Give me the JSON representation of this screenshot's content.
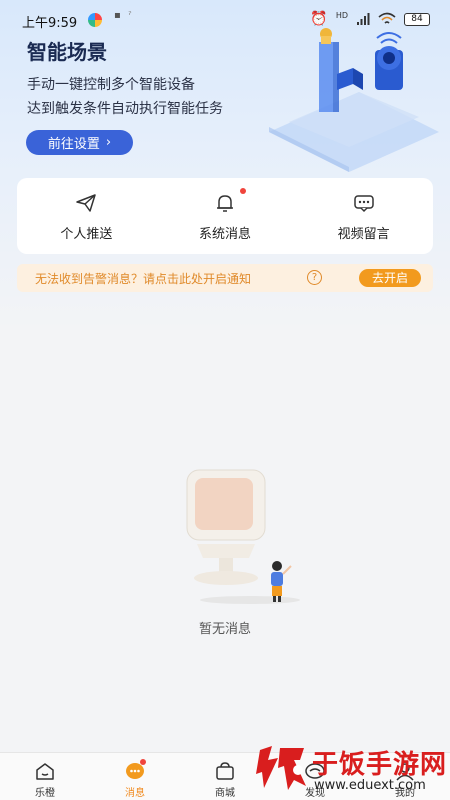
{
  "status_bar": {
    "time": "上午9:59",
    "hd_label": "HD",
    "battery": "84",
    "icons": [
      "app-dot-icon",
      "alarm-icon",
      "signal-icon",
      "wifi-icon",
      "battery-icon"
    ]
  },
  "hero": {
    "title": "智能场景",
    "line1": "手动一键控制多个智能设备",
    "line2": "达到触发条件自动执行智能任务",
    "button_label": "前往设置",
    "button_chevron": "›"
  },
  "entries": [
    {
      "label": "个人推送",
      "icon": "send-icon"
    },
    {
      "label": "系统消息",
      "icon": "bell-icon",
      "has_badge": true
    },
    {
      "label": "视频留言",
      "icon": "message-icon"
    }
  ],
  "notice": {
    "text": "无法收到告警消息？请点击此处开启通知",
    "help": "?",
    "button_label": "去开启"
  },
  "empty_state": {
    "text": "暂无消息"
  },
  "bottom_nav": {
    "items": [
      {
        "label": "乐橙",
        "icon": "home-icon"
      },
      {
        "label": "消息",
        "icon": "chat-icon",
        "active": true,
        "has_badge": true
      },
      {
        "label": "商城",
        "icon": "bag-icon"
      },
      {
        "label": "发现",
        "icon": "discover-icon"
      },
      {
        "label": "我的",
        "icon": "profile-icon"
      }
    ]
  },
  "watermark": {
    "name": "于饭手游网",
    "url": "www.eduext.com"
  },
  "colors": {
    "accent_blue": "#3a63d8",
    "accent_orange": "#f29a1e",
    "badge_red": "#f0443c",
    "notice_bg": "#fdf0e0"
  }
}
